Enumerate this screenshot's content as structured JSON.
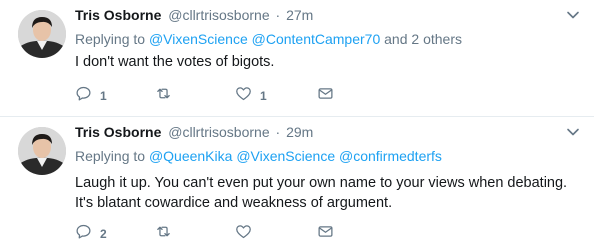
{
  "tweets": [
    {
      "name": "Tris Osborne",
      "handle": "@cllrtrisosborne",
      "separator": "·",
      "time": "27m",
      "replying_prefix": "Replying to",
      "mentions": [
        "@VixenScience",
        "@ContentCamper70"
      ],
      "replying_suffix": "and 2 others",
      "text": "I don't want the votes of bigots.",
      "reply_count": "1",
      "retweet_count": "",
      "like_count": "1"
    },
    {
      "name": "Tris Osborne",
      "handle": "@cllrtrisosborne",
      "separator": "·",
      "time": "29m",
      "replying_prefix": "Replying to",
      "mentions": [
        "@QueenKika",
        "@VixenScience",
        "@confirmedterfs"
      ],
      "replying_suffix": "",
      "text": "Laugh it up. You can't even put your own name to your views when debating. It's blatant cowardice and weakness of argument.",
      "reply_count": "2",
      "retweet_count": "",
      "like_count": ""
    }
  ],
  "icons": {
    "reply": "reply-icon",
    "retweet": "retweet-icon",
    "like": "heart-icon",
    "dm": "envelope-icon",
    "menu": "chevron-down-icon"
  },
  "colors": {
    "link": "#1da1f2",
    "secondary_text": "#657786",
    "primary_text": "#14171a",
    "divider": "#e6ecf0"
  }
}
